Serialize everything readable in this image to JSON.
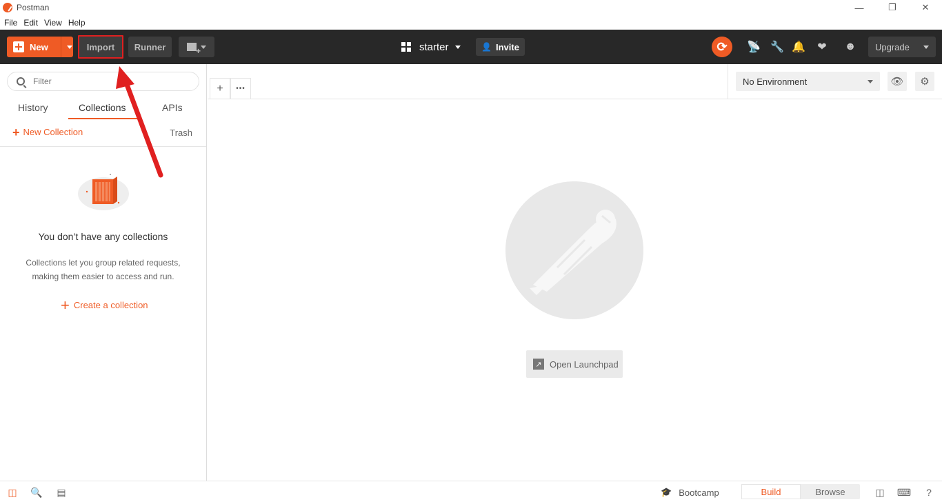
{
  "window": {
    "title": "Postman",
    "controls": {
      "minimize": "—",
      "restore": "❐",
      "close": "✕"
    }
  },
  "menu": [
    "File",
    "Edit",
    "View",
    "Help"
  ],
  "toolbar": {
    "new_label": "New",
    "import_label": "Import",
    "runner_label": "Runner",
    "workspace_name": "starter",
    "invite_label": "Invite",
    "upgrade_label": "Upgrade",
    "icons": [
      "sync-icon",
      "satellite-icon",
      "wrench-icon",
      "bell-icon",
      "heart-icon",
      "avatar-icon"
    ]
  },
  "sidebar": {
    "filter_placeholder": "Filter",
    "tabs": [
      "History",
      "Collections",
      "APIs"
    ],
    "active_tab": "Collections",
    "new_collection_label": "New Collection",
    "trash_label": "Trash",
    "empty_title": "You don’t have any collections",
    "empty_desc": "Collections let you group related requests, making them easier to access and run.",
    "create_collection_label": "Create a collection"
  },
  "main": {
    "tab_add": "+",
    "tab_more": "•••",
    "environment": "No Environment",
    "open_launchpad_label": "Open Launchpad"
  },
  "statusbar": {
    "bootcamp_label": "Bootcamp",
    "build_label": "Build",
    "browse_label": "Browse",
    "active_mode": "Build"
  },
  "colors": {
    "accent": "#ef5b25",
    "toolbar_bg": "#282828",
    "annotation": "#e02020"
  }
}
